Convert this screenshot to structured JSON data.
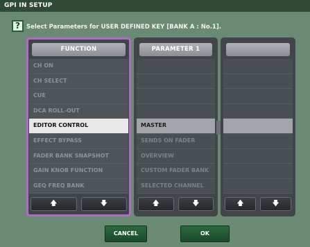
{
  "window": {
    "title": "GPI IN SETUP",
    "instruction": "Select Parameters for USER DEFINED KEY [BANK A : No.1].",
    "help_icon": "?"
  },
  "columns": {
    "function": {
      "header": "FUNCTION",
      "items": [
        "CH ON",
        "CH SELECT",
        "CUE",
        "DCA ROLL-OUT",
        "EDITOR CONTROL",
        "EFFECT BYPASS",
        "FADER BANK SNAPSHOT",
        "GAIN KNOB FUNCTION",
        "GEQ FREQ BANK"
      ],
      "selected": "EDITOR CONTROL"
    },
    "parameter1": {
      "header": "PARAMETER 1",
      "items": [
        "",
        "",
        "",
        "",
        "MASTER",
        "SENDS ON FADER",
        "OVERVIEW",
        "CUSTOM FADER BANK",
        "SELECTED CHANNEL"
      ],
      "selected": "MASTER"
    },
    "parameter2": {
      "header": "",
      "items": [
        "",
        "",
        "",
        "",
        "",
        "",
        "",
        "",
        ""
      ]
    }
  },
  "arrows": {
    "up": "🡅",
    "down": "🡇"
  },
  "buttons": {
    "cancel": "CANCEL",
    "ok": "OK"
  },
  "colors": {
    "window_bg": "#6a8a74",
    "title_bar": "#2e4a37",
    "function_highlight_border": "#b06bc4",
    "button_green": "#2b6a3f"
  }
}
